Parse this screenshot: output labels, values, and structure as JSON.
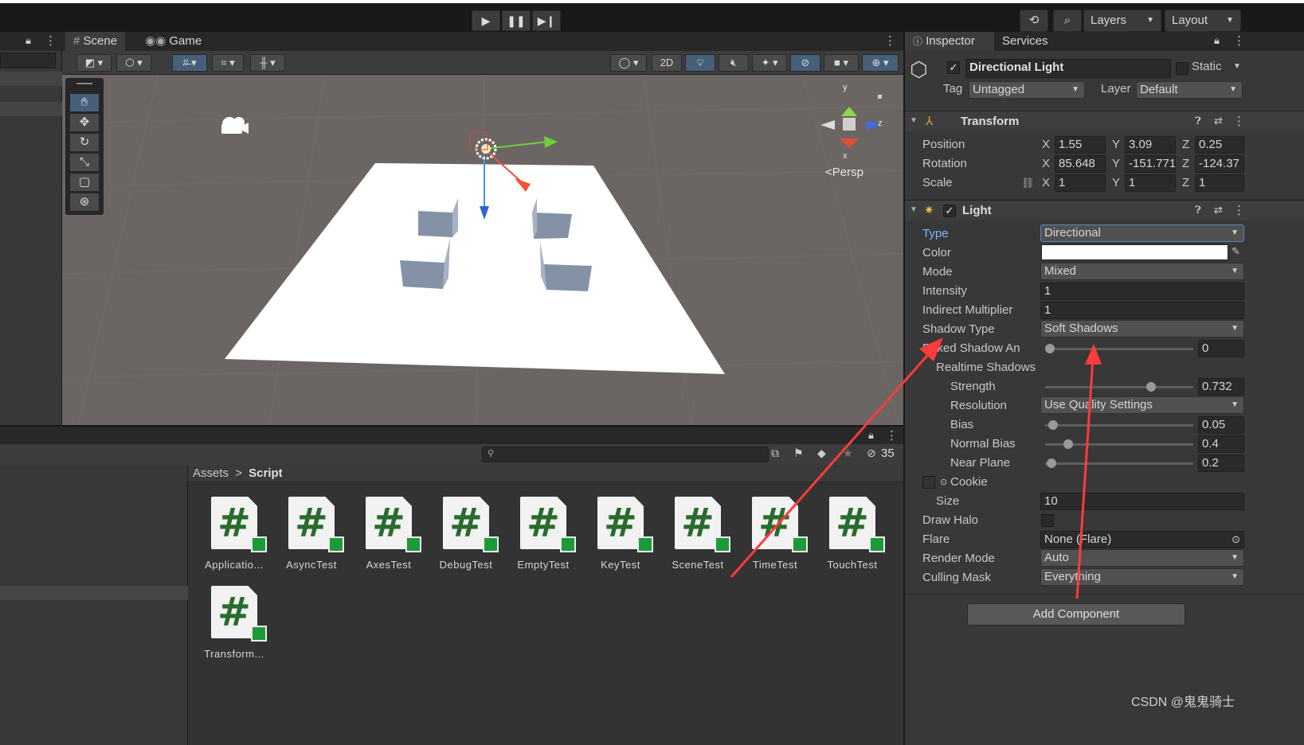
{
  "toolbar": {
    "play_icon": "play-icon",
    "pause_icon": "pause-icon",
    "step_icon": "step-icon",
    "layers_label": "Layers",
    "layout_label": "Layout"
  },
  "scene": {
    "tabs": [
      {
        "label": "Scene"
      },
      {
        "label": "Game"
      }
    ],
    "btn_2d": "2D",
    "persp_label": "<Persp",
    "axis_y": "y",
    "axis_z": "z",
    "axis_x": "x"
  },
  "project": {
    "breadcrumb_root": "Assets",
    "breadcrumb_sep": ">",
    "breadcrumb_current": "Script",
    "hidden_count": "35",
    "assets": [
      {
        "label": "Applicatio..."
      },
      {
        "label": "AsyncTest"
      },
      {
        "label": "AxesTest"
      },
      {
        "label": "DebugTest"
      },
      {
        "label": "EmptyTest"
      },
      {
        "label": "KeyTest"
      },
      {
        "label": "SceneTest"
      },
      {
        "label": "TimeTest"
      },
      {
        "label": "TouchTest"
      },
      {
        "label": "Transform..."
      }
    ],
    "asset_glyph": "#"
  },
  "inspector": {
    "tabs": [
      {
        "label": "Inspector"
      },
      {
        "label": "Services"
      }
    ],
    "object_name": "Directional Light",
    "static_label": "Static",
    "tag_label": "Tag",
    "tag_value": "Untagged",
    "layer_label": "Layer",
    "layer_value": "Default",
    "transform": {
      "title": "Transform",
      "position_label": "Position",
      "rotation_label": "Rotation",
      "scale_label": "Scale",
      "x": "X",
      "y": "Y",
      "z": "Z",
      "position": {
        "x": "1.55",
        "y": "3.09",
        "z": "0.25"
      },
      "rotation": {
        "x": "85.648",
        "y": "-151.771",
        "z": "-124.37"
      },
      "scale": {
        "x": "1",
        "y": "1",
        "z": "1"
      }
    },
    "light": {
      "title": "Light",
      "type_label": "Type",
      "type_value": "Directional",
      "color_label": "Color",
      "mode_label": "Mode",
      "mode_value": "Mixed",
      "intensity_label": "Intensity",
      "intensity_value": "1",
      "indirect_label": "Indirect Multiplier",
      "indirect_value": "1",
      "shadow_type_label": "Shadow Type",
      "shadow_type_value": "Soft Shadows",
      "baked_label": "Baked Shadow An",
      "baked_value": "0",
      "baked_fraction": 0.0,
      "realtime_label": "Realtime Shadows",
      "strength_label": "Strength",
      "strength_value": "0.732",
      "strength_fraction": 0.732,
      "resolution_label": "Resolution",
      "resolution_value": "Use Quality Settings",
      "bias_label": "Bias",
      "bias_value": "0.05",
      "bias_fraction": 0.025,
      "normal_bias_label": "Normal Bias",
      "normal_bias_value": "0.4",
      "normal_bias_fraction": 0.13,
      "near_plane_label": "Near Plane",
      "near_plane_value": "0.2",
      "near_plane_fraction": 0.01,
      "cookie_label": "Cookie",
      "size_label": "Size",
      "size_value": "10",
      "draw_halo_label": "Draw Halo",
      "flare_label": "Flare",
      "flare_value": "None (Flare)",
      "render_mode_label": "Render Mode",
      "render_mode_value": "Auto",
      "culling_label": "Culling Mask",
      "culling_value": "Everything"
    },
    "add_component": "Add Component"
  },
  "watermark": "CSDN @鬼鬼骑士",
  "colors": {
    "annotation_arrow": "#ff3b3b",
    "accent_link": "#7eb6ff",
    "asset_badge": "#1c9a3a"
  }
}
